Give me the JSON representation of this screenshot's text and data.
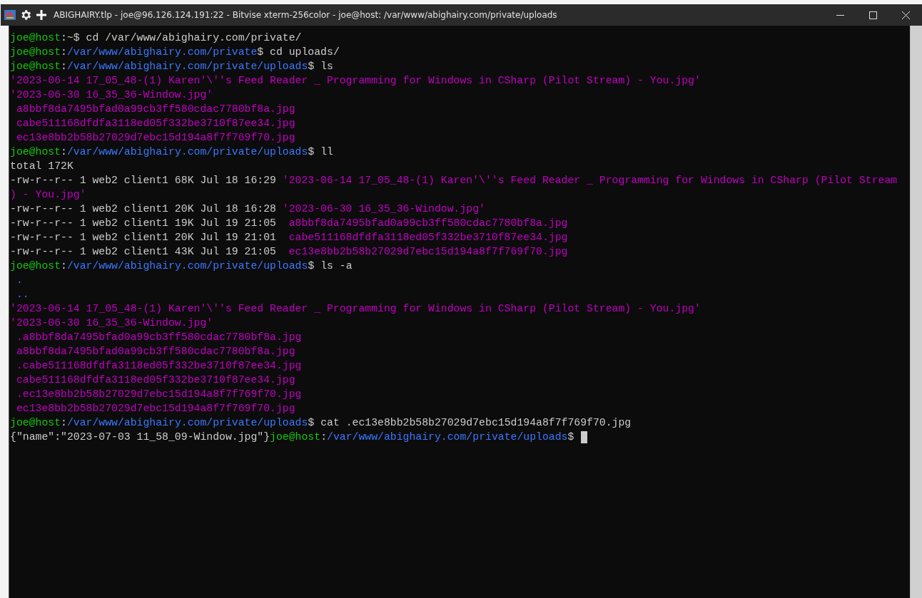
{
  "window": {
    "title": "ABIGHAIRY.tlp - joe@96.126.124.191:22 - Bitvise xterm-256color - joe@host: /var/www/abighairy.com/private/uploads"
  },
  "terminal": {
    "lines": [
      {
        "segments": [
          {
            "kind": "user",
            "text": "joe@host"
          },
          {
            "kind": "plain",
            "text": ":~$ cd /var/www/abighairy.com/private/"
          }
        ]
      },
      {
        "segments": [
          {
            "kind": "user",
            "text": "joe@host"
          },
          {
            "kind": "plain",
            "text": ":"
          },
          {
            "kind": "path",
            "text": "/var/www/abighairy.com/private"
          },
          {
            "kind": "plain",
            "text": "$ cd uploads/"
          }
        ]
      },
      {
        "segments": [
          {
            "kind": "user",
            "text": "joe@host"
          },
          {
            "kind": "plain",
            "text": ":"
          },
          {
            "kind": "path",
            "text": "/var/www/abighairy.com/private/uploads"
          },
          {
            "kind": "plain",
            "text": "$ ls"
          }
        ]
      },
      {
        "segments": [
          {
            "kind": "file",
            "text": "'2023-06-14 17_05_48-(1) Karen'\\''s Feed Reader _ Programming for Windows in CSharp (Pilot Stream) - You.jpg'"
          }
        ]
      },
      {
        "segments": [
          {
            "kind": "file",
            "text": "'2023-06-30 16_35_36-Window.jpg'"
          }
        ]
      },
      {
        "segments": [
          {
            "kind": "file",
            "text": " a8bbf8da7495bfad0a99cb3ff580cdac7780bf8a.jpg"
          }
        ]
      },
      {
        "segments": [
          {
            "kind": "file",
            "text": " cabe511168dfdfa3118ed05f332be3710f87ee34.jpg"
          }
        ]
      },
      {
        "segments": [
          {
            "kind": "file",
            "text": " ec13e8bb2b58b27029d7ebc15d194a8f7f769f70.jpg"
          }
        ]
      },
      {
        "segments": [
          {
            "kind": "user",
            "text": "joe@host"
          },
          {
            "kind": "plain",
            "text": ":"
          },
          {
            "kind": "path",
            "text": "/var/www/abighairy.com/private/uploads"
          },
          {
            "kind": "plain",
            "text": "$ ll"
          }
        ]
      },
      {
        "segments": [
          {
            "kind": "plain",
            "text": "total 172K"
          }
        ]
      },
      {
        "segments": [
          {
            "kind": "plain",
            "text": "-rw-r--r-- 1 web2 client1 68K Jul 18 16:29 "
          },
          {
            "kind": "file",
            "text": "'2023-06-14 17_05_48-(1) Karen'\\''s Feed Reader _ Programming for Windows in CSharp (Pilot Stream"
          }
        ]
      },
      {
        "segments": [
          {
            "kind": "file",
            "text": ") - You.jpg'"
          }
        ]
      },
      {
        "segments": [
          {
            "kind": "plain",
            "text": "-rw-r--r-- 1 web2 client1 20K Jul 18 16:28 "
          },
          {
            "kind": "file",
            "text": "'2023-06-30 16_35_36-Window.jpg'"
          }
        ]
      },
      {
        "segments": [
          {
            "kind": "plain",
            "text": "-rw-r--r-- 1 web2 client1 19K Jul 19 21:05 "
          },
          {
            "kind": "file",
            "text": " a8bbf8da7495bfad0a99cb3ff580cdac7780bf8a.jpg"
          }
        ]
      },
      {
        "segments": [
          {
            "kind": "plain",
            "text": "-rw-r--r-- 1 web2 client1 20K Jul 19 21:01 "
          },
          {
            "kind": "file",
            "text": " cabe511168dfdfa3118ed05f332be3710f87ee34.jpg"
          }
        ]
      },
      {
        "segments": [
          {
            "kind": "plain",
            "text": "-rw-r--r-- 1 web2 client1 43K Jul 19 21:05 "
          },
          {
            "kind": "file",
            "text": " ec13e8bb2b58b27029d7ebc15d194a8f7f769f70.jpg"
          }
        ]
      },
      {
        "segments": [
          {
            "kind": "user",
            "text": "joe@host"
          },
          {
            "kind": "plain",
            "text": ":"
          },
          {
            "kind": "path",
            "text": "/var/www/abighairy.com/private/uploads"
          },
          {
            "kind": "plain",
            "text": "$ ls -a"
          }
        ]
      },
      {
        "segments": [
          {
            "kind": "path",
            "text": " ."
          }
        ]
      },
      {
        "segments": [
          {
            "kind": "path",
            "text": " .."
          }
        ]
      },
      {
        "segments": [
          {
            "kind": "file",
            "text": "'2023-06-14 17_05_48-(1) Karen'\\''s Feed Reader _ Programming for Windows in CSharp (Pilot Stream) - You.jpg'"
          }
        ]
      },
      {
        "segments": [
          {
            "kind": "file",
            "text": "'2023-06-30 16_35_36-Window.jpg'"
          }
        ]
      },
      {
        "segments": [
          {
            "kind": "file",
            "text": " .a8bbf8da7495bfad0a99cb3ff580cdac7780bf8a.jpg"
          }
        ]
      },
      {
        "segments": [
          {
            "kind": "file",
            "text": " a8bbf8da7495bfad0a99cb3ff580cdac7780bf8a.jpg"
          }
        ]
      },
      {
        "segments": [
          {
            "kind": "file",
            "text": " .cabe511168dfdfa3118ed05f332be3710f87ee34.jpg"
          }
        ]
      },
      {
        "segments": [
          {
            "kind": "file",
            "text": " cabe511168dfdfa3118ed05f332be3710f87ee34.jpg"
          }
        ]
      },
      {
        "segments": [
          {
            "kind": "file",
            "text": " .ec13e8bb2b58b27029d7ebc15d194a8f7f769f70.jpg"
          }
        ]
      },
      {
        "segments": [
          {
            "kind": "file",
            "text": " ec13e8bb2b58b27029d7ebc15d194a8f7f769f70.jpg"
          }
        ]
      },
      {
        "segments": [
          {
            "kind": "user",
            "text": "joe@host"
          },
          {
            "kind": "plain",
            "text": ":"
          },
          {
            "kind": "path",
            "text": "/var/www/abighairy.com/private/uploads"
          },
          {
            "kind": "plain",
            "text": "$ cat .ec13e8bb2b58b27029d7ebc15d194a8f7f769f70.jpg"
          }
        ]
      },
      {
        "segments": [
          {
            "kind": "plain",
            "text": "{\"name\":\"2023-07-03 11_58_09-Window.jpg\"}"
          },
          {
            "kind": "user",
            "text": "joe@host"
          },
          {
            "kind": "plain",
            "text": ":"
          },
          {
            "kind": "path",
            "text": "/var/www/abighairy.com/private/uploads"
          },
          {
            "kind": "plain",
            "text": "$ "
          }
        ],
        "cursor": true
      }
    ]
  }
}
